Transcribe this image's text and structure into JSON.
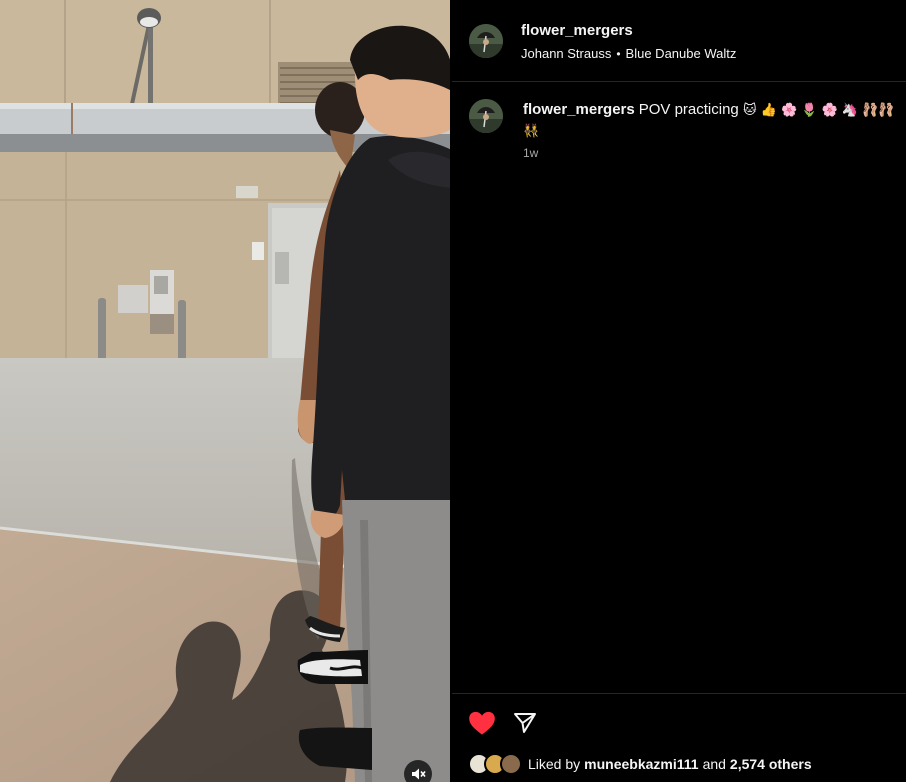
{
  "post": {
    "username": "flower_mergers",
    "audio": {
      "artist": "Johann Strauss",
      "separator": "•",
      "track": "Blue Danube Waltz"
    }
  },
  "caption": {
    "username": "flower_mergers",
    "text": "POV practicing",
    "emojis_line1": "🐱 👍 🌸 🌷 🌸 🦄 🩰🩰",
    "emojis_line2": "👯",
    "time": "1w"
  },
  "actions": {
    "like_icon": "heart-filled-icon",
    "share_icon": "paper-plane-icon",
    "liked_state": true,
    "like_color": "#ff3040"
  },
  "likes": {
    "prefix": "Liked by",
    "user": "muneebkazmi111",
    "conjunction": "and",
    "others": "2,574 others"
  },
  "video": {
    "mute_icon": "speaker-muted-icon"
  }
}
